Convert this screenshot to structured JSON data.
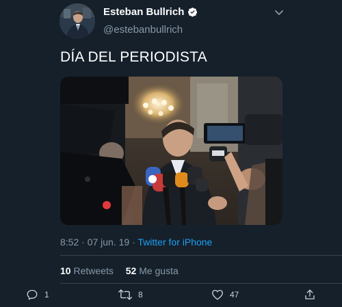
{
  "author": {
    "display_name": "Esteban Bullrich",
    "handle": "@estebanbullrich",
    "verified": true
  },
  "tweet": {
    "text": "DÍA DEL PERIODISTA",
    "time": "8:52",
    "separator": " · ",
    "date": "07 jun. 19",
    "source": "Twitter for iPhone"
  },
  "stats": {
    "retweets_count": "10",
    "retweets_label": "Retweets",
    "likes_count": "52",
    "likes_label": "Me gusta"
  },
  "actions": {
    "reply_count": "1",
    "retweet_count": "8",
    "like_count": "47"
  },
  "icons": {
    "verified": "verified-badge-icon",
    "caret": "chevron-down-icon",
    "reply": "reply-icon",
    "retweet": "retweet-icon",
    "like": "heart-icon",
    "share": "share-icon"
  },
  "colors": {
    "background": "#15202b",
    "text_primary": "#ffffff",
    "text_secondary": "#8899a6",
    "link": "#1da1f2",
    "divider": "#38444d"
  }
}
